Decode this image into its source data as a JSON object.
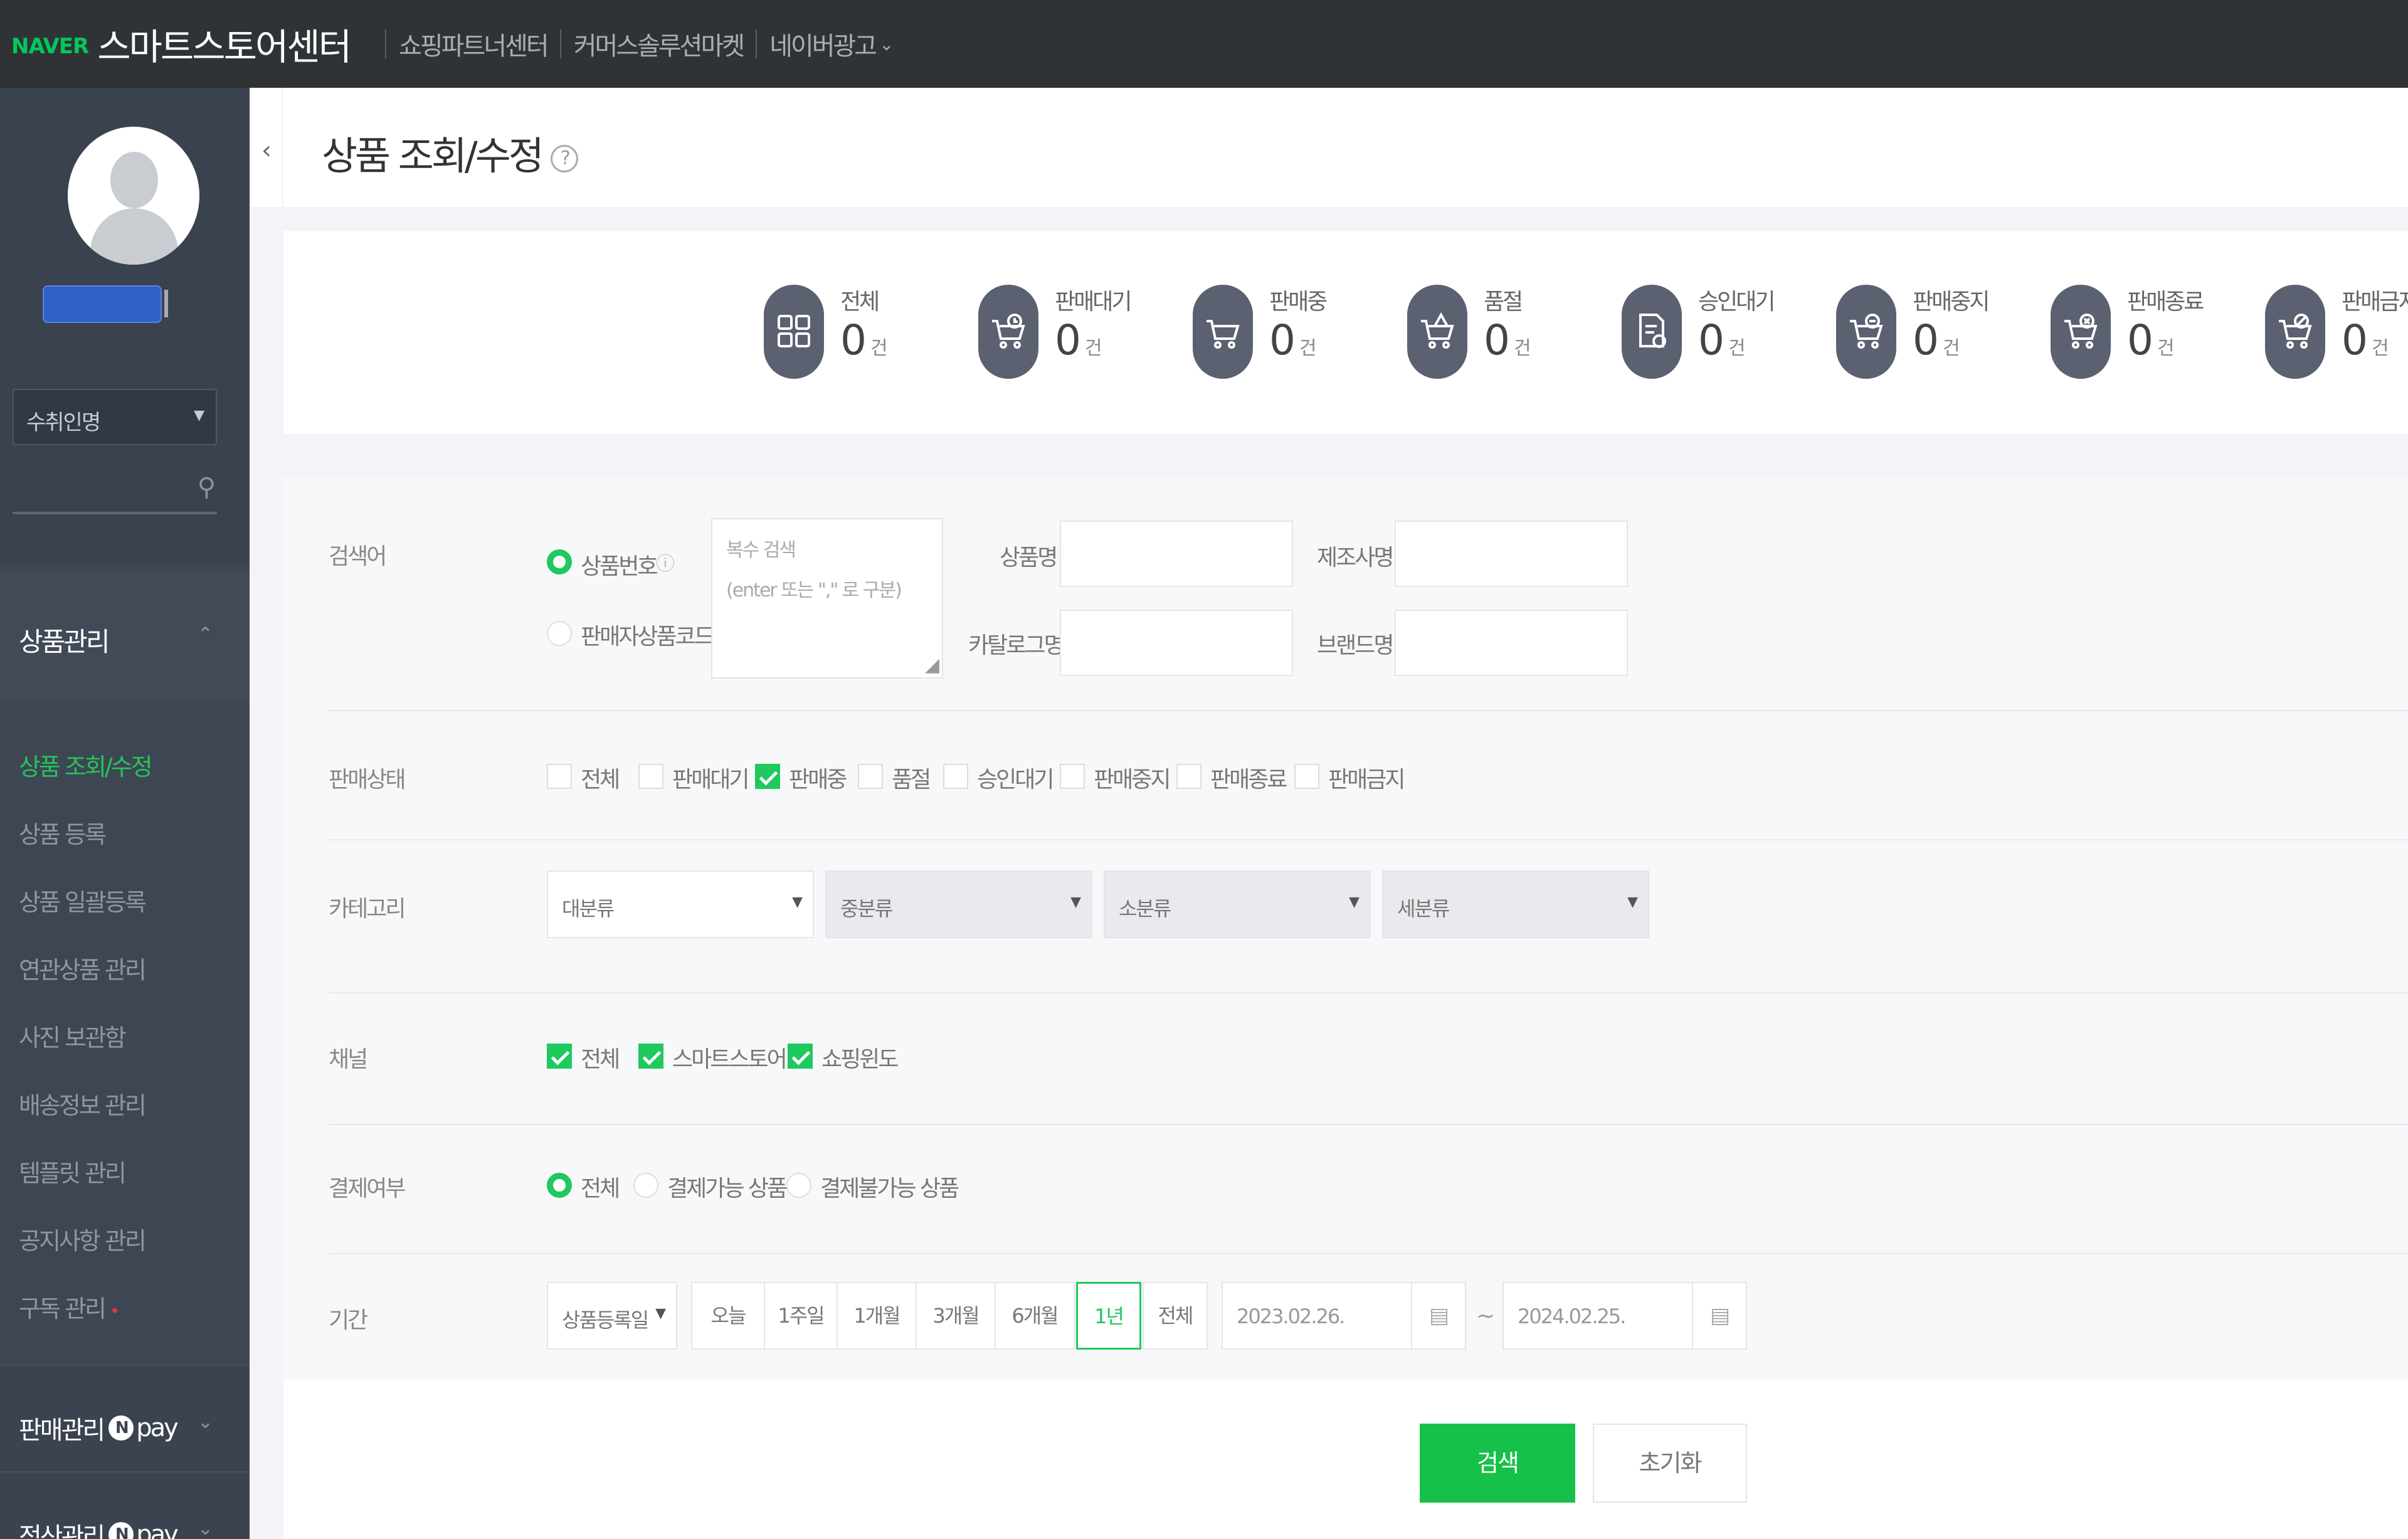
{
  "topbar": {
    "brand": "NAVER",
    "title": "스마트스토어센터",
    "links": [
      "쇼핑파트너센터",
      "커머스솔루션마켓",
      "네이버광고"
    ]
  },
  "sidebar": {
    "store_select": "수취인명",
    "section_title": "상품관리",
    "items": [
      {
        "label": "상품 조회/수정",
        "active": true
      },
      {
        "label": "상품 등록"
      },
      {
        "label": "상품 일괄등록"
      },
      {
        "label": "연관상품 관리"
      },
      {
        "label": "사진 보관함"
      },
      {
        "label": "배송정보 관리"
      },
      {
        "label": "템플릿 관리"
      },
      {
        "label": "공지사항 관리"
      },
      {
        "label": "구독 관리",
        "badge": "•"
      }
    ],
    "pay_menus": [
      {
        "label": "판매관리",
        "suffix": "pay"
      },
      {
        "label": "정산관리",
        "suffix": "pay"
      }
    ]
  },
  "header": {
    "title": "상품 조회/수정",
    "help": "?"
  },
  "status_cards": [
    {
      "label": "전체",
      "count": "0",
      "unit": "건",
      "icon": "grid-icon"
    },
    {
      "label": "판매대기",
      "count": "0",
      "unit": "건",
      "icon": "cart-clock-icon"
    },
    {
      "label": "판매중",
      "count": "0",
      "unit": "건",
      "icon": "cart-icon"
    },
    {
      "label": "품절",
      "count": "0",
      "unit": "건",
      "icon": "cart-warning-icon"
    },
    {
      "label": "승인대기",
      "count": "0",
      "unit": "건",
      "icon": "document-clock-icon"
    },
    {
      "label": "판매중지",
      "count": "0",
      "unit": "건",
      "icon": "cart-pause-icon"
    },
    {
      "label": "판매종료",
      "count": "0",
      "unit": "건",
      "icon": "cart-x-icon"
    },
    {
      "label": "판매금지",
      "count": "0",
      "unit": "건",
      "icon": "cart-ban-icon"
    }
  ],
  "search": {
    "keyword_label": "검색어",
    "keyword_types": [
      {
        "label": "상품번호",
        "selected": true
      },
      {
        "label": "판매자상품코드",
        "selected": false
      }
    ],
    "multi_placeholder_line1": "복수 검색",
    "multi_placeholder_line2": "(enter 또는 \",\" 로 구분)",
    "fields": {
      "product_name": "상품명",
      "maker": "제조사명",
      "catalog": "카탈로그명",
      "brand": "브랜드명"
    },
    "sale_status_label": "판매상태",
    "sale_status": [
      {
        "label": "전체",
        "checked": false
      },
      {
        "label": "판매대기",
        "checked": false
      },
      {
        "label": "판매중",
        "checked": true
      },
      {
        "label": "품절",
        "checked": false
      },
      {
        "label": "승인대기",
        "checked": false
      },
      {
        "label": "판매중지",
        "checked": false
      },
      {
        "label": "판매종료",
        "checked": false
      },
      {
        "label": "판매금지",
        "checked": false
      }
    ],
    "category_label": "카테고리",
    "categories": [
      "대분류",
      "중분류",
      "소분류",
      "세분류"
    ],
    "channel_label": "채널",
    "channels": [
      {
        "label": "전체",
        "checked": true
      },
      {
        "label": "스마트스토어",
        "checked": true
      },
      {
        "label": "쇼핑윈도",
        "checked": true
      }
    ],
    "payment_label": "결제여부",
    "payments": [
      {
        "label": "전체",
        "selected": true
      },
      {
        "label": "결제가능 상품",
        "selected": false
      },
      {
        "label": "결제불가능 상품",
        "selected": false
      }
    ],
    "period_label": "기간",
    "period_type": "상품등록일",
    "period_buttons": [
      "오늘",
      "1주일",
      "1개월",
      "3개월",
      "6개월",
      "1년",
      "전체"
    ],
    "period_active": "1년",
    "date_from": "2023.02.26.",
    "date_to": "2024.02.25.",
    "date_sep": "~"
  },
  "actions": {
    "search": "검색",
    "reset": "초기화"
  },
  "colors": {
    "accent": "#1ec95d",
    "topbar": "#2f3336",
    "sidebar": "#3e4653"
  }
}
